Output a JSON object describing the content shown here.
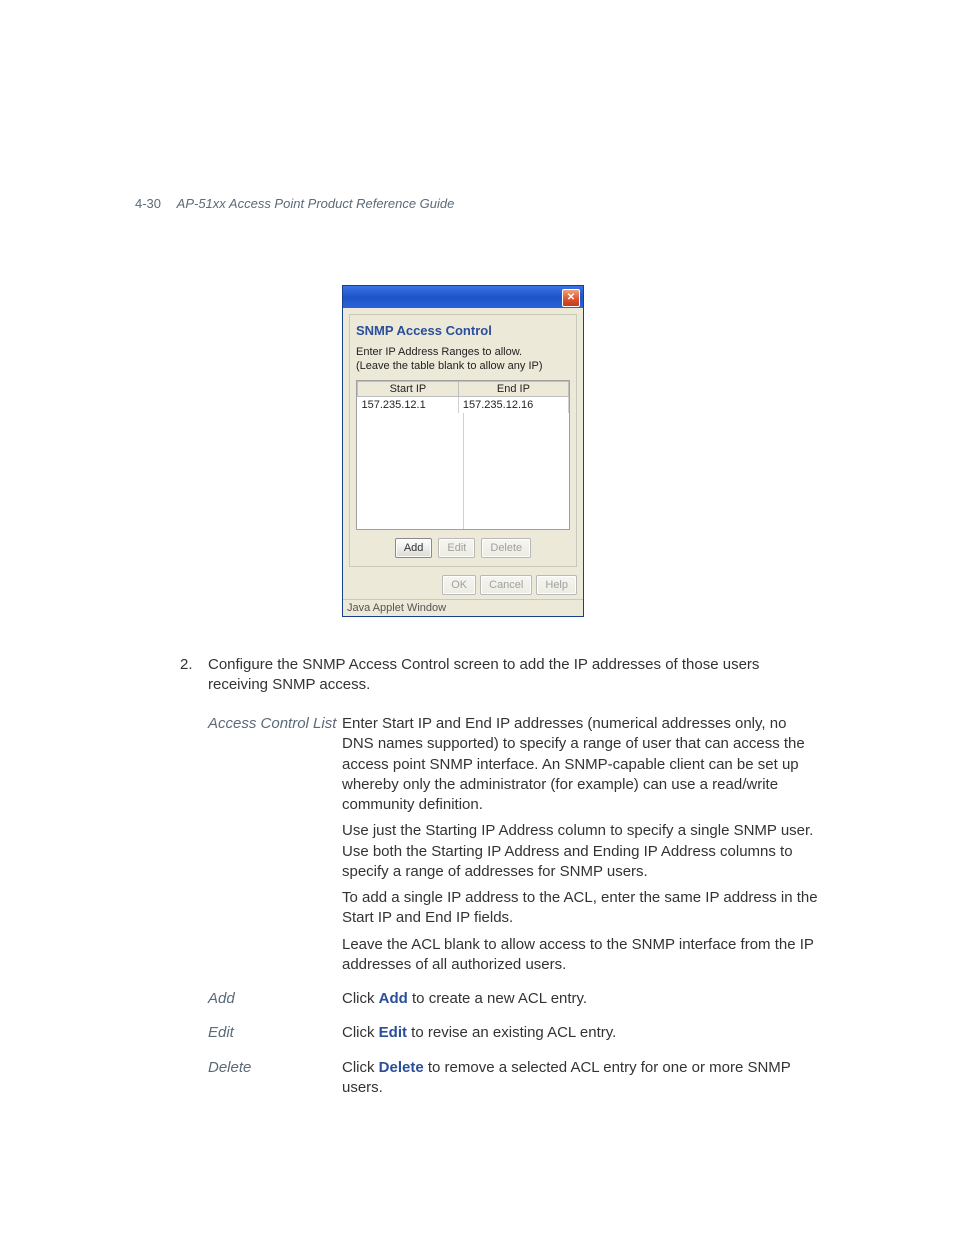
{
  "header": {
    "page_number": "4-30",
    "title": "AP-51xx Access Point Product Reference Guide"
  },
  "dialog": {
    "section_title": "SNMP Access Control",
    "instructions_line1": "Enter IP Address Ranges to allow.",
    "instructions_line2": "(Leave the table blank to allow any IP)",
    "col_start": "Start IP",
    "col_end": "End IP",
    "row_start": "157.235.12.1",
    "row_end": "157.235.12.16",
    "add": "Add",
    "edit": "Edit",
    "delete": "Delete",
    "ok": "OK",
    "cancel": "Cancel",
    "help": "Help",
    "status": "Java Applet Window"
  },
  "step": {
    "number": "2.",
    "text": "Configure the SNMP Access Control screen to add the IP addresses of those users receiving SNMP access."
  },
  "defs": {
    "acl": {
      "term": "Access Control List",
      "p1": "Enter Start IP and End IP addresses (numerical addresses only, no DNS names supported) to specify a range of user that can access the access point SNMP interface. An SNMP-capable client can be set up whereby only the administrator (for example) can use a read/write community definition.",
      "p2": "Use just the Starting IP Address column to specify a single SNMP user. Use both the Starting IP Address and Ending IP Address columns to specify a range of addresses for SNMP users.",
      "p3": "To add a single IP address to the ACL, enter the same IP address in the Start IP and End IP fields.",
      "p4": "Leave the ACL blank to allow access to the SNMP interface from the IP addresses of all authorized users."
    },
    "add": {
      "term": "Add",
      "pre": "Click ",
      "kw": "Add",
      "post": " to create a new ACL entry."
    },
    "edit": {
      "term": "Edit",
      "pre": "Click ",
      "kw": "Edit",
      "post": " to revise an existing ACL entry."
    },
    "deleteRow": {
      "term": "Delete",
      "pre": "Click ",
      "kw": "Delete",
      "post": " to remove a selected ACL entry for one or more SNMP users."
    }
  }
}
